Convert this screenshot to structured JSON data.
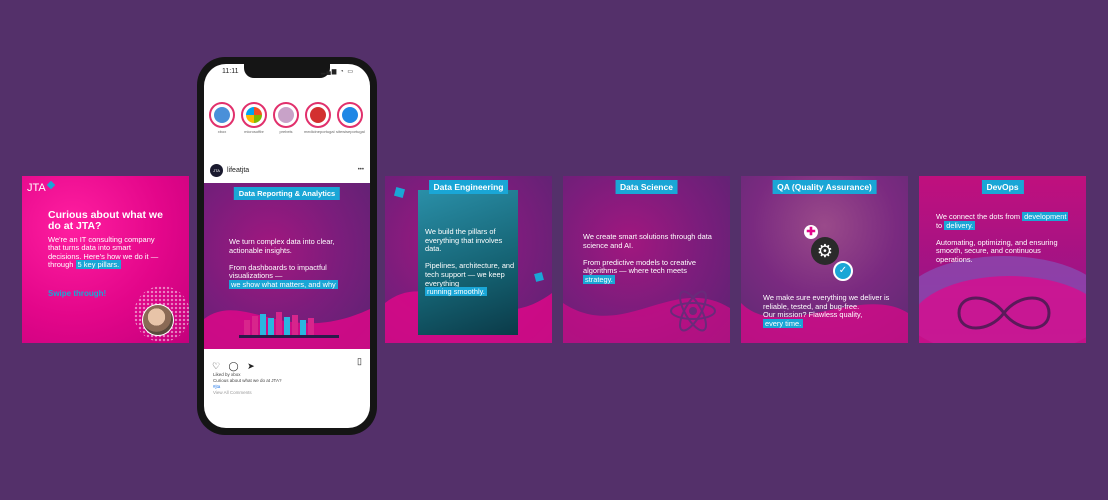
{
  "intro": {
    "logo": "JTA",
    "headline": "Curious about what we do at JTA?",
    "body": "We're an IT consulting company that turns data into smart decisions. Here's how we do it — through",
    "highlight": "5 key pillars.",
    "cta": "Swipe through!"
  },
  "phone": {
    "time": "11:11",
    "status_icons": "▂▄▆ ◔ ▭",
    "stories": [
      {
        "label": "xbox",
        "color": "#4a90d9"
      },
      {
        "label": "microsoftbr",
        "color": "#7fba00"
      },
      {
        "label": "prebels",
        "color": "#c8a2c8"
      },
      {
        "label": "medicineportugal",
        "color": "#d32f2f"
      },
      {
        "label": "sitewiseportugal",
        "color": "#1e88e5"
      }
    ],
    "username": "lifeatjta",
    "avatar_text": "JTA",
    "more_icon": "•••",
    "post": {
      "title": "Data Reporting & Analytics",
      "text1": "We turn complex data into clear, actionable insights.",
      "text2": "From dashboards to impactful visualizations —",
      "highlight": "we show what matters, and why"
    },
    "liked_by": "Liked by xbox",
    "caption": "Curious about what we do at JTA?",
    "hashtag": "#jta",
    "view_comments": "View All Comments"
  },
  "cards": [
    {
      "title": "Data Engineering",
      "text1": "We build the pillars of everything that involves data.",
      "text2": "Pipelines, architecture, and tech support — we keep everything",
      "highlight": "running smoothly."
    },
    {
      "title": "Data Science",
      "text1": "We create smart solutions through data science and AI.",
      "text2": "From predictive models to creative algorithms — where tech meets",
      "highlight": "strategy."
    },
    {
      "title": "QA (Quality Assurance)",
      "text1": "We make sure everything we deliver is reliable, tested, and bug-free.",
      "text2": "Our mission? Flawless quality,",
      "highlight": "every time."
    },
    {
      "title": "DevOps",
      "text1a": "We connect the dots from",
      "hl1": "development",
      "text1b": "to",
      "hl2": "delivery.",
      "text2": "Automating, optimizing, and ensuring smooth, secure, and continuous operations."
    }
  ],
  "colors": {
    "background": "#54306a",
    "accent": "#1aa6d6",
    "pink": "#e3068a",
    "purple": "#7b1d7c"
  }
}
